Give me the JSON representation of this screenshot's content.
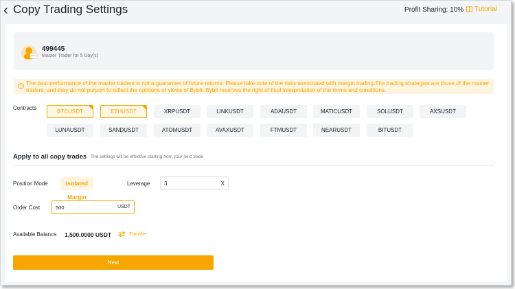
{
  "header": {
    "back_glyph": "‹",
    "title": "Copy Trading Settings",
    "profit_sharing": "Profit Sharing: 10%",
    "tutorial": "Tutorial"
  },
  "trader": {
    "name": "499445",
    "subtitle": "Master Trader for 5 Day(s)"
  },
  "warning": {
    "text": "The past performance of the master traders is not a guarantee of future returns. Please take note of the risks associated with margin trading.The trading strategies are those of the master traders, and they do not purport to reflect the opinions or views of Bybit. Bybit reserves the right of final interpretation of the terms and conditions."
  },
  "contracts": {
    "label": "Contracts",
    "items": [
      {
        "label": "BTCUSDT",
        "selected": true
      },
      {
        "label": "ETHUSDT",
        "selected": true
      },
      {
        "label": "XRPUSDT",
        "selected": false
      },
      {
        "label": "LINKUSDT",
        "selected": false
      },
      {
        "label": "ADAUSDT",
        "selected": false
      },
      {
        "label": "MATICUSDT",
        "selected": false
      },
      {
        "label": "SOLUSDT",
        "selected": false
      },
      {
        "label": "AXSUSDT",
        "selected": false
      },
      {
        "label": "LUNAUSDT",
        "selected": false
      },
      {
        "label": "SANDUSDT",
        "selected": false
      },
      {
        "label": "ATOMUSDT",
        "selected": false
      },
      {
        "label": "AVAXUSDT",
        "selected": false
      },
      {
        "label": "FTMUSDT",
        "selected": false
      },
      {
        "label": "NEARUSDT",
        "selected": false
      },
      {
        "label": "BITUSDT",
        "selected": false
      }
    ]
  },
  "apply": {
    "title": "Apply to all copy trades",
    "subtitle": "The settings will be effective starting from your next trade"
  },
  "position_mode": {
    "label": "Position Mode",
    "value": "Isolated",
    "margin_label": "Margin"
  },
  "leverage": {
    "label": "Leverage",
    "value": "3",
    "suffix": "X"
  },
  "order_cost": {
    "label": "Order Cost",
    "value": "500",
    "unit": "USDT"
  },
  "balance": {
    "label": "Available Balance",
    "value": "1,500.0000 USDT",
    "transfer": "Transfer"
  },
  "next_button": "Next",
  "colors": {
    "accent": "#f7a600",
    "accent_bg": "#fff4e0",
    "page_bg": "#f3f4f6"
  }
}
